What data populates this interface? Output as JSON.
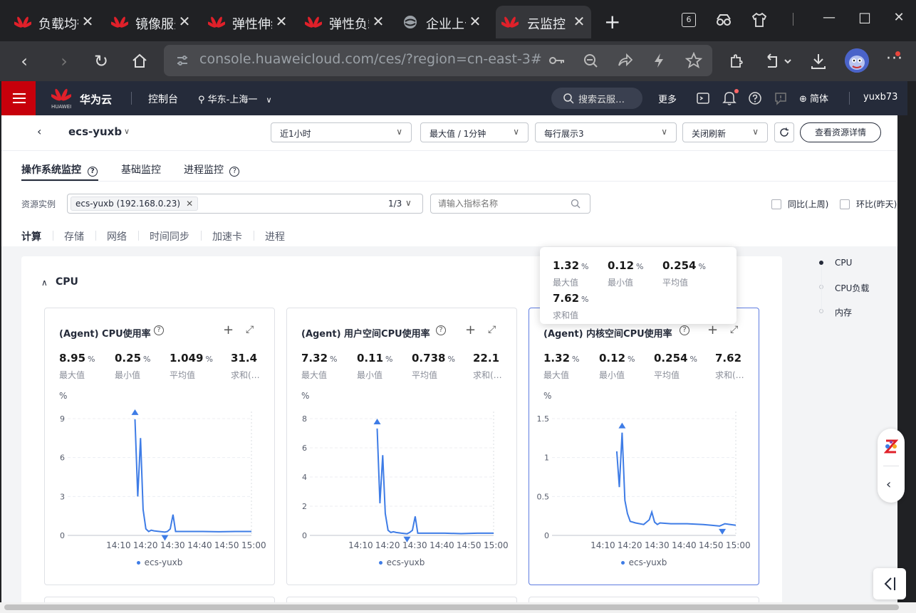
{
  "browser": {
    "tabs": [
      {
        "title": "负载均衡"
      },
      {
        "title": "镜像服务"
      },
      {
        "title": "弹性伸缩"
      },
      {
        "title": "弹性负载"
      },
      {
        "title": "企业上云"
      },
      {
        "title": "云监控"
      }
    ],
    "tab_count_badge": "6",
    "url": "console.huaweicloud.com/ces/?region=cn-east-3#/h…"
  },
  "header": {
    "brand": "华为云",
    "logo_text": "HUAWEI",
    "console": "控制台",
    "region": "华东-上海一",
    "search_placeholder": "搜索云服…",
    "more": "更多",
    "lang": "简体",
    "user": "yuxb73"
  },
  "toolbar": {
    "instance_name": "ecs-yuxb",
    "time_range": "近1小时",
    "aggregation": "最大值 / 1分钟",
    "per_row": "每行展示3",
    "refresh": "关闭刷新",
    "details_button": "查看资源详情"
  },
  "tabs": [
    {
      "label": "操作系统监控",
      "active": true
    },
    {
      "label": "基础监控",
      "active": false
    },
    {
      "label": "进程监控",
      "active": false
    }
  ],
  "filter": {
    "label": "资源实例",
    "chip": "ecs-yuxb (192.168.0.23)",
    "count": "1/3",
    "search_placeholder": "请输入指标名称",
    "yoy": "同比(上周)",
    "mom": "环比(昨天)"
  },
  "categories": [
    "计算",
    "存储",
    "网络",
    "时间同步",
    "加速卡",
    "进程"
  ],
  "section": {
    "title": "CPU"
  },
  "anchors": [
    "CPU",
    "CPU负载",
    "内存"
  ],
  "tooltip": {
    "stats": [
      {
        "value": "1.32",
        "unit": "%",
        "label": "最大值"
      },
      {
        "value": "0.12",
        "unit": "%",
        "label": "最小值"
      },
      {
        "value": "0.254",
        "unit": "%",
        "label": "平均值"
      },
      {
        "value": "7.62",
        "unit": "%",
        "label": "求和值"
      }
    ]
  },
  "cards": [
    {
      "title": "(Agent) CPU使用率",
      "stats": [
        {
          "value": "8.95",
          "unit": "%",
          "label": "最大值"
        },
        {
          "value": "0.25",
          "unit": "%",
          "label": "最小值"
        },
        {
          "value": "1.049",
          "unit": "%",
          "label": "平均值"
        },
        {
          "value": "31.4",
          "unit": "",
          "label": "求和(…"
        }
      ],
      "unit_label": "%",
      "legend": "ecs-yuxb"
    },
    {
      "title": "(Agent) 用户空间CPU使用率",
      "stats": [
        {
          "value": "7.32",
          "unit": "%",
          "label": "最大值"
        },
        {
          "value": "0.11",
          "unit": "%",
          "label": "最小值"
        },
        {
          "value": "0.738",
          "unit": "%",
          "label": "平均值"
        },
        {
          "value": "22.1",
          "unit": "",
          "label": "求和(…"
        }
      ],
      "unit_label": "%",
      "legend": "ecs-yuxb"
    },
    {
      "title": "(Agent) 内核空间CPU使用率",
      "stats": [
        {
          "value": "1.32",
          "unit": "%",
          "label": "最大值"
        },
        {
          "value": "0.12",
          "unit": "%",
          "label": "最小值"
        },
        {
          "value": "0.254",
          "unit": "%",
          "label": "平均值"
        },
        {
          "value": "7.62",
          "unit": "",
          "label": "求和(…"
        }
      ],
      "unit_label": "%",
      "legend": "ecs-yuxb"
    }
  ],
  "chart_data": [
    {
      "type": "line",
      "title": "(Agent) CPU使用率",
      "ylabel": "%",
      "xticks": [
        "14:10",
        "14:20",
        "14:30",
        "14:40",
        "14:50",
        "15:00"
      ],
      "yticks": [
        0,
        3,
        6,
        9
      ],
      "ylim": [
        0,
        9
      ],
      "xlim": [
        14.0,
        15.0
      ],
      "series": [
        {
          "name": "ecs-yuxb",
          "x": [
            14.283,
            14.3,
            14.317,
            14.333,
            14.35,
            14.367,
            14.383,
            14.4,
            14.433,
            14.467,
            14.483,
            14.5,
            14.517,
            14.533,
            14.6,
            14.7,
            14.8,
            14.9,
            15.0
          ],
          "y": [
            8.95,
            3.0,
            7.5,
            2.0,
            0.5,
            0.3,
            0.4,
            0.35,
            0.3,
            0.25,
            0.3,
            0.5,
            1.6,
            0.3,
            0.3,
            0.3,
            0.28,
            0.3,
            0.3
          ]
        }
      ],
      "max_marker": {
        "x": 14.283,
        "y": 8.95
      },
      "min_marker": {
        "x": 14.467,
        "y": 0.25
      }
    },
    {
      "type": "line",
      "title": "(Agent) 用户空间CPU使用率",
      "ylabel": "%",
      "xticks": [
        "14:10",
        "14:20",
        "14:30",
        "14:40",
        "14:50",
        "15:00"
      ],
      "yticks": [
        0,
        2,
        4,
        6,
        8
      ],
      "ylim": [
        0,
        8
      ],
      "xlim": [
        14.0,
        15.0
      ],
      "series": [
        {
          "name": "ecs-yuxb",
          "x": [
            14.283,
            14.3,
            14.317,
            14.333,
            14.35,
            14.367,
            14.383,
            14.4,
            14.433,
            14.467,
            14.483,
            14.5,
            14.517,
            14.533,
            14.6,
            14.7,
            14.8,
            14.9,
            15.0
          ],
          "y": [
            7.32,
            2.2,
            5.5,
            1.5,
            0.35,
            0.2,
            0.25,
            0.2,
            0.15,
            0.11,
            0.2,
            0.35,
            1.3,
            0.15,
            0.15,
            0.15,
            0.12,
            0.15,
            0.15
          ]
        }
      ],
      "max_marker": {
        "x": 14.283,
        "y": 7.32
      },
      "min_marker": {
        "x": 14.467,
        "y": 0.11
      }
    },
    {
      "type": "line",
      "title": "(Agent) 内核空间CPU使用率",
      "ylabel": "%",
      "xticks": [
        "14:10",
        "14:20",
        "14:30",
        "14:40",
        "14:50",
        "15:00"
      ],
      "yticks": [
        0,
        0.5,
        1,
        1.5
      ],
      "ylim": [
        0,
        1.5
      ],
      "xlim": [
        14.0,
        15.0
      ],
      "series": [
        {
          "name": "ecs-yuxb",
          "x": [
            14.267,
            14.283,
            14.3,
            14.317,
            14.333,
            14.35,
            14.383,
            14.433,
            14.467,
            14.483,
            14.5,
            14.517,
            14.533,
            14.6,
            14.7,
            14.8,
            14.85,
            14.9,
            14.933,
            14.967,
            15.0
          ],
          "y": [
            1.08,
            0.62,
            1.32,
            0.45,
            0.28,
            0.18,
            0.16,
            0.14,
            0.2,
            0.3,
            0.17,
            0.14,
            0.16,
            0.15,
            0.15,
            0.14,
            0.13,
            0.12,
            0.15,
            0.14,
            0.13
          ]
        }
      ],
      "max_marker": {
        "x": 14.3,
        "y": 1.32
      },
      "min_marker": {
        "x": 14.917,
        "y": 0.12
      }
    }
  ]
}
